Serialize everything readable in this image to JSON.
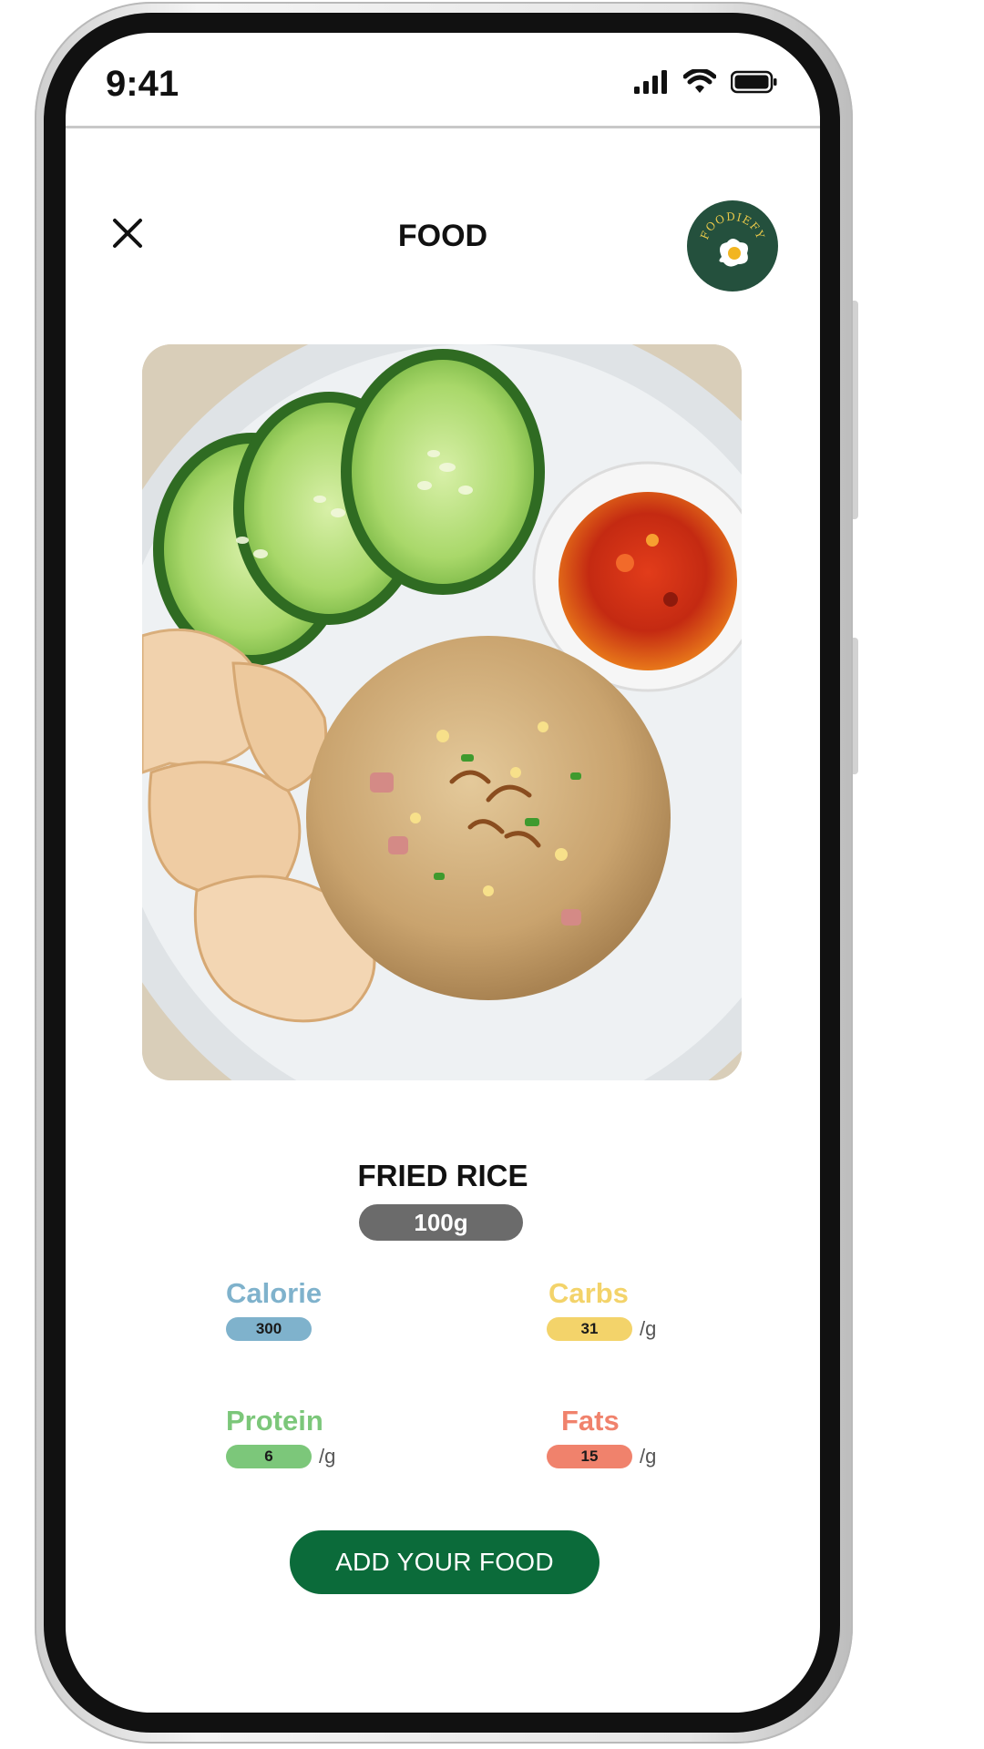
{
  "status_bar": {
    "time": "9:41"
  },
  "header": {
    "title": "FOOD",
    "close_icon": "close-icon",
    "logo_text": "FOODIEFY"
  },
  "food": {
    "name": "FRIED RICE",
    "portion": "100g"
  },
  "nutrition": {
    "calorie": {
      "label": "Calorie",
      "value": "300",
      "unit": "",
      "color": "#7fb2cc"
    },
    "carbs": {
      "label": "Carbs",
      "value": "31",
      "unit": "/g",
      "color": "#f3d36a"
    },
    "protein": {
      "label": "Protein",
      "value": "6",
      "unit": "/g",
      "color": "#7cc77a"
    },
    "fats": {
      "label": "Fats",
      "value": "15",
      "unit": "/g",
      "color": "#f0826c"
    }
  },
  "actions": {
    "add_label": "ADD YOUR FOOD"
  },
  "colors": {
    "brand_green": "#0b6b3a",
    "logo_green": "#24503d",
    "badge_gray": "#6b6b6b"
  }
}
